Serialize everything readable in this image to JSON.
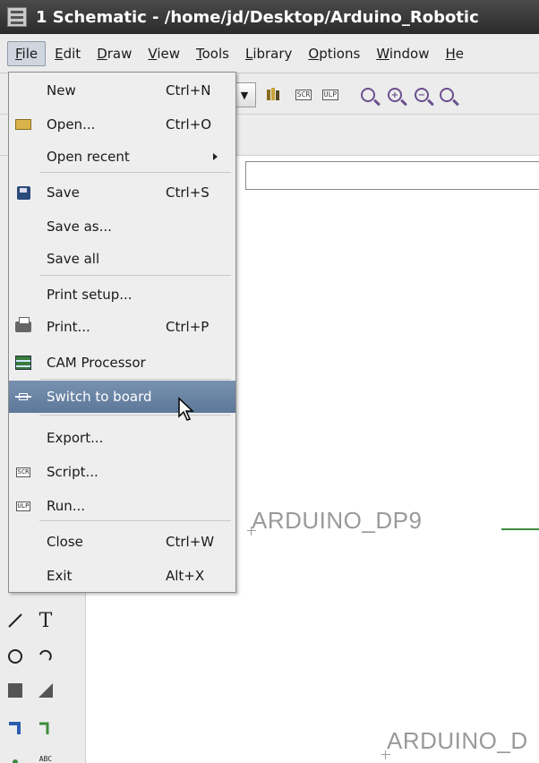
{
  "window": {
    "title": "1 Schematic - /home/jd/Desktop/Arduino_Robotic"
  },
  "menubar": {
    "items": [
      {
        "label": "File",
        "u": "F",
        "rest": "ile"
      },
      {
        "label": "Edit",
        "u": "E",
        "rest": "dit"
      },
      {
        "label": "Draw",
        "u": "D",
        "rest": "raw"
      },
      {
        "label": "View",
        "u": "V",
        "rest": "iew"
      },
      {
        "label": "Tools",
        "u": "T",
        "rest": "ools"
      },
      {
        "label": "Library",
        "u": "L",
        "rest": "ibrary"
      },
      {
        "label": "Options",
        "u": "O",
        "rest": "ptions"
      },
      {
        "label": "Window",
        "u": "W",
        "rest": "indow"
      },
      {
        "label": "He",
        "u": "H",
        "rest": "e"
      }
    ]
  },
  "toolbar": {
    "scr": "SCR",
    "ulp": "ULP"
  },
  "file_menu": {
    "items": [
      {
        "label": "New",
        "shortcut": "Ctrl+N",
        "icon": "none"
      },
      {
        "label": "Open...",
        "shortcut": "Ctrl+O",
        "icon": "folder-open-icon"
      },
      {
        "label": "Open recent",
        "shortcut": "",
        "icon": "none",
        "submenu": true
      },
      {
        "label": "Save",
        "shortcut": "Ctrl+S",
        "icon": "floppy-icon"
      },
      {
        "label": "Save as...",
        "shortcut": "",
        "icon": "none"
      },
      {
        "label": "Save all",
        "shortcut": "",
        "icon": "none"
      },
      {
        "label": "Print setup...",
        "shortcut": "",
        "icon": "none"
      },
      {
        "label": "Print...",
        "shortcut": "Ctrl+P",
        "icon": "printer-icon"
      },
      {
        "label": "CAM Processor",
        "shortcut": "",
        "icon": "cam-icon"
      },
      {
        "label": "Switch to board",
        "shortcut": "",
        "icon": "board-icon",
        "highlighted": true
      },
      {
        "label": "Export...",
        "shortcut": "",
        "icon": "none"
      },
      {
        "label": "Script...",
        "shortcut": "",
        "icon": "script-icon",
        "icon_text": "SCR"
      },
      {
        "label": "Run...",
        "shortcut": "",
        "icon": "ulp-icon",
        "icon_text": "ULP"
      },
      {
        "label": "Close",
        "shortcut": "Ctrl+W",
        "icon": "none"
      },
      {
        "label": "Exit",
        "shortcut": "Alt+X",
        "icon": "none"
      }
    ]
  },
  "left_tools": {
    "text_tool": "T",
    "abc_tool": "ABC"
  },
  "canvas": {
    "label_1": "ARDUINO_DP9",
    "label_2": "ARDUINO_D"
  },
  "colors": {
    "highlight": "#6883a6",
    "wire": "#3e8b3e",
    "canvas_text": "#9a9a9a"
  }
}
